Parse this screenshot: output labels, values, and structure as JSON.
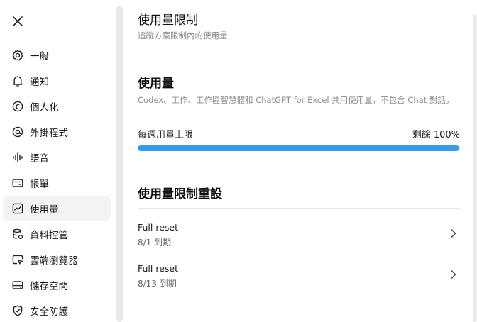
{
  "sidebar": {
    "close_icon": "close-icon",
    "items": [
      {
        "label": "一般",
        "icon": "gear-icon"
      },
      {
        "label": "通知",
        "icon": "bell-icon"
      },
      {
        "label": "個人化",
        "icon": "personalize-icon"
      },
      {
        "label": "外掛程式",
        "icon": "plugin-icon"
      },
      {
        "label": "語音",
        "icon": "waveform-icon"
      },
      {
        "label": "帳單",
        "icon": "card-icon"
      },
      {
        "label": "使用量",
        "icon": "chart-icon",
        "active": true
      },
      {
        "label": "資料控管",
        "icon": "database-icon"
      },
      {
        "label": "雲端瀏覽器",
        "icon": "cloud-browser-icon"
      },
      {
        "label": "儲存空間",
        "icon": "storage-icon"
      },
      {
        "label": "安全防護",
        "icon": "shield-icon"
      }
    ]
  },
  "main": {
    "title": "使用量限制",
    "subtitle": "追蹤方案限制內的使用量",
    "usage": {
      "title": "使用量",
      "description": "Codex、工作、工作區智慧體和 ChatGPT for Excel 共用使用量，不包含 Chat 對話。",
      "limit_label": "每週用量上限",
      "remaining": "剩餘 100%",
      "remaining_fraction": 1.0
    },
    "resets": {
      "title": "使用量限制重設",
      "items": [
        {
          "name": "Full reset",
          "date": "8/1 到期"
        },
        {
          "name": "Full reset",
          "date": "8/13 到期"
        }
      ]
    }
  },
  "colors": {
    "accent": "#339af0",
    "active_bg": "#f3f3f3"
  }
}
